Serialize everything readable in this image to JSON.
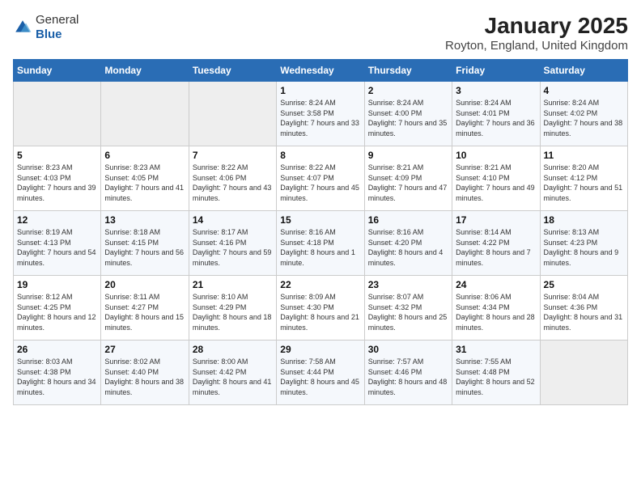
{
  "logo": {
    "general": "General",
    "blue": "Blue"
  },
  "header": {
    "month": "January 2025",
    "location": "Royton, England, United Kingdom"
  },
  "weekdays": [
    "Sunday",
    "Monday",
    "Tuesday",
    "Wednesday",
    "Thursday",
    "Friday",
    "Saturday"
  ],
  "weeks": [
    [
      {
        "day": "",
        "sunrise": "",
        "sunset": "",
        "daylight": ""
      },
      {
        "day": "",
        "sunrise": "",
        "sunset": "",
        "daylight": ""
      },
      {
        "day": "",
        "sunrise": "",
        "sunset": "",
        "daylight": ""
      },
      {
        "day": "1",
        "sunrise": "Sunrise: 8:24 AM",
        "sunset": "Sunset: 3:58 PM",
        "daylight": "Daylight: 7 hours and 33 minutes."
      },
      {
        "day": "2",
        "sunrise": "Sunrise: 8:24 AM",
        "sunset": "Sunset: 4:00 PM",
        "daylight": "Daylight: 7 hours and 35 minutes."
      },
      {
        "day": "3",
        "sunrise": "Sunrise: 8:24 AM",
        "sunset": "Sunset: 4:01 PM",
        "daylight": "Daylight: 7 hours and 36 minutes."
      },
      {
        "day": "4",
        "sunrise": "Sunrise: 8:24 AM",
        "sunset": "Sunset: 4:02 PM",
        "daylight": "Daylight: 7 hours and 38 minutes."
      }
    ],
    [
      {
        "day": "5",
        "sunrise": "Sunrise: 8:23 AM",
        "sunset": "Sunset: 4:03 PM",
        "daylight": "Daylight: 7 hours and 39 minutes."
      },
      {
        "day": "6",
        "sunrise": "Sunrise: 8:23 AM",
        "sunset": "Sunset: 4:05 PM",
        "daylight": "Daylight: 7 hours and 41 minutes."
      },
      {
        "day": "7",
        "sunrise": "Sunrise: 8:22 AM",
        "sunset": "Sunset: 4:06 PM",
        "daylight": "Daylight: 7 hours and 43 minutes."
      },
      {
        "day": "8",
        "sunrise": "Sunrise: 8:22 AM",
        "sunset": "Sunset: 4:07 PM",
        "daylight": "Daylight: 7 hours and 45 minutes."
      },
      {
        "day": "9",
        "sunrise": "Sunrise: 8:21 AM",
        "sunset": "Sunset: 4:09 PM",
        "daylight": "Daylight: 7 hours and 47 minutes."
      },
      {
        "day": "10",
        "sunrise": "Sunrise: 8:21 AM",
        "sunset": "Sunset: 4:10 PM",
        "daylight": "Daylight: 7 hours and 49 minutes."
      },
      {
        "day": "11",
        "sunrise": "Sunrise: 8:20 AM",
        "sunset": "Sunset: 4:12 PM",
        "daylight": "Daylight: 7 hours and 51 minutes."
      }
    ],
    [
      {
        "day": "12",
        "sunrise": "Sunrise: 8:19 AM",
        "sunset": "Sunset: 4:13 PM",
        "daylight": "Daylight: 7 hours and 54 minutes."
      },
      {
        "day": "13",
        "sunrise": "Sunrise: 8:18 AM",
        "sunset": "Sunset: 4:15 PM",
        "daylight": "Daylight: 7 hours and 56 minutes."
      },
      {
        "day": "14",
        "sunrise": "Sunrise: 8:17 AM",
        "sunset": "Sunset: 4:16 PM",
        "daylight": "Daylight: 7 hours and 59 minutes."
      },
      {
        "day": "15",
        "sunrise": "Sunrise: 8:16 AM",
        "sunset": "Sunset: 4:18 PM",
        "daylight": "Daylight: 8 hours and 1 minute."
      },
      {
        "day": "16",
        "sunrise": "Sunrise: 8:16 AM",
        "sunset": "Sunset: 4:20 PM",
        "daylight": "Daylight: 8 hours and 4 minutes."
      },
      {
        "day": "17",
        "sunrise": "Sunrise: 8:14 AM",
        "sunset": "Sunset: 4:22 PM",
        "daylight": "Daylight: 8 hours and 7 minutes."
      },
      {
        "day": "18",
        "sunrise": "Sunrise: 8:13 AM",
        "sunset": "Sunset: 4:23 PM",
        "daylight": "Daylight: 8 hours and 9 minutes."
      }
    ],
    [
      {
        "day": "19",
        "sunrise": "Sunrise: 8:12 AM",
        "sunset": "Sunset: 4:25 PM",
        "daylight": "Daylight: 8 hours and 12 minutes."
      },
      {
        "day": "20",
        "sunrise": "Sunrise: 8:11 AM",
        "sunset": "Sunset: 4:27 PM",
        "daylight": "Daylight: 8 hours and 15 minutes."
      },
      {
        "day": "21",
        "sunrise": "Sunrise: 8:10 AM",
        "sunset": "Sunset: 4:29 PM",
        "daylight": "Daylight: 8 hours and 18 minutes."
      },
      {
        "day": "22",
        "sunrise": "Sunrise: 8:09 AM",
        "sunset": "Sunset: 4:30 PM",
        "daylight": "Daylight: 8 hours and 21 minutes."
      },
      {
        "day": "23",
        "sunrise": "Sunrise: 8:07 AM",
        "sunset": "Sunset: 4:32 PM",
        "daylight": "Daylight: 8 hours and 25 minutes."
      },
      {
        "day": "24",
        "sunrise": "Sunrise: 8:06 AM",
        "sunset": "Sunset: 4:34 PM",
        "daylight": "Daylight: 8 hours and 28 minutes."
      },
      {
        "day": "25",
        "sunrise": "Sunrise: 8:04 AM",
        "sunset": "Sunset: 4:36 PM",
        "daylight": "Daylight: 8 hours and 31 minutes."
      }
    ],
    [
      {
        "day": "26",
        "sunrise": "Sunrise: 8:03 AM",
        "sunset": "Sunset: 4:38 PM",
        "daylight": "Daylight: 8 hours and 34 minutes."
      },
      {
        "day": "27",
        "sunrise": "Sunrise: 8:02 AM",
        "sunset": "Sunset: 4:40 PM",
        "daylight": "Daylight: 8 hours and 38 minutes."
      },
      {
        "day": "28",
        "sunrise": "Sunrise: 8:00 AM",
        "sunset": "Sunset: 4:42 PM",
        "daylight": "Daylight: 8 hours and 41 minutes."
      },
      {
        "day": "29",
        "sunrise": "Sunrise: 7:58 AM",
        "sunset": "Sunset: 4:44 PM",
        "daylight": "Daylight: 8 hours and 45 minutes."
      },
      {
        "day": "30",
        "sunrise": "Sunrise: 7:57 AM",
        "sunset": "Sunset: 4:46 PM",
        "daylight": "Daylight: 8 hours and 48 minutes."
      },
      {
        "day": "31",
        "sunrise": "Sunrise: 7:55 AM",
        "sunset": "Sunset: 4:48 PM",
        "daylight": "Daylight: 8 hours and 52 minutes."
      },
      {
        "day": "",
        "sunrise": "",
        "sunset": "",
        "daylight": ""
      }
    ]
  ]
}
